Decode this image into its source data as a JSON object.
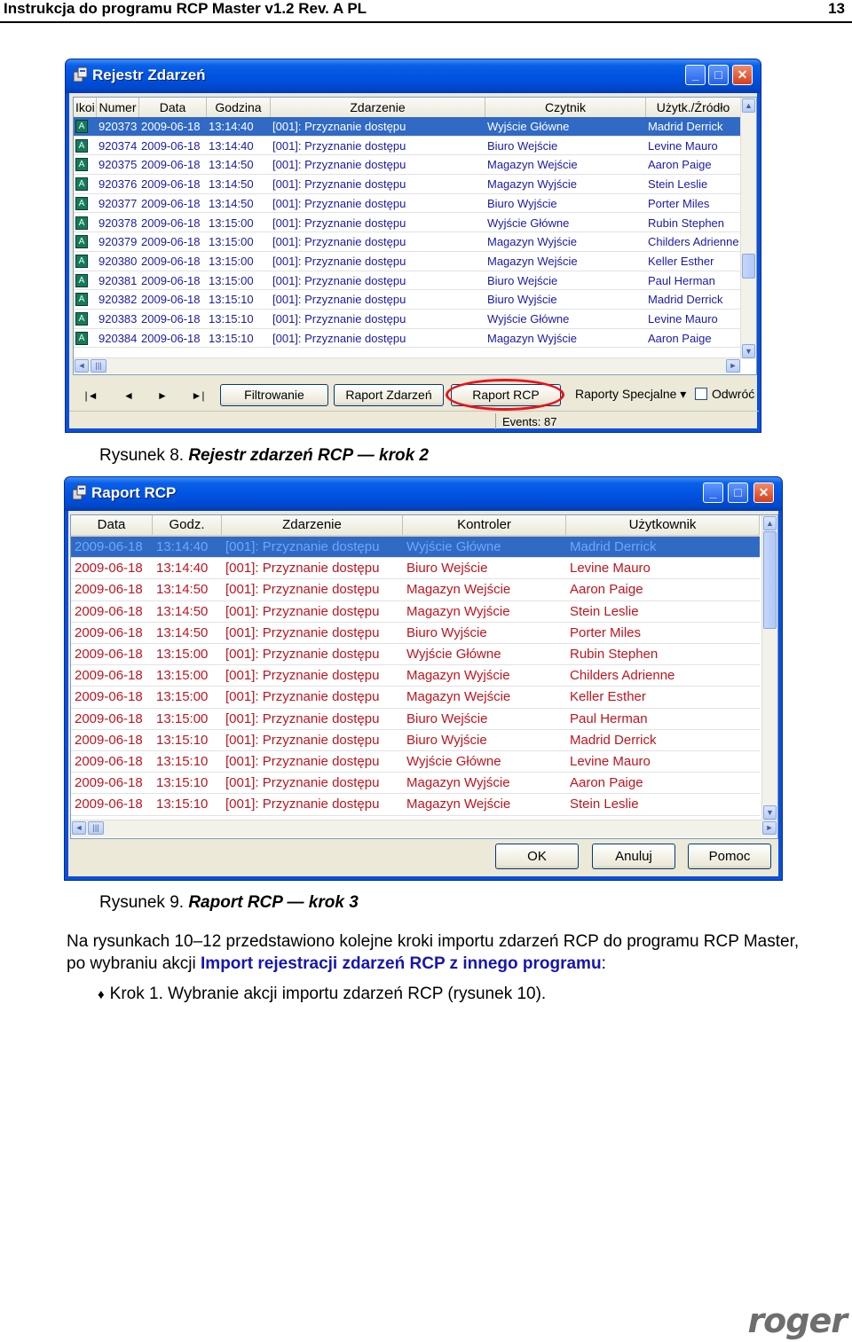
{
  "doc": {
    "header_title": "Instrukcja do programu  RCP Master v1.2 Rev. A PL",
    "page_number": "13"
  },
  "win1": {
    "title": "Rejestr Zdarzeń",
    "columns": [
      "Ikoi",
      "Numer",
      "Data",
      "Godzina",
      "Zdarzenie",
      "Czytnik",
      "Użytk./Źródło"
    ],
    "rows": [
      [
        "920373",
        "2009-06-18",
        "13:14:40",
        "[001]: Przyznanie dostępu",
        "Wyjście Główne",
        "Madrid Derrick"
      ],
      [
        "920374",
        "2009-06-18",
        "13:14:40",
        "[001]: Przyznanie dostępu",
        "Biuro Wejście",
        "Levine Mauro"
      ],
      [
        "920375",
        "2009-06-18",
        "13:14:50",
        "[001]: Przyznanie dostępu",
        "Magazyn Wejście",
        "Aaron Paige"
      ],
      [
        "920376",
        "2009-06-18",
        "13:14:50",
        "[001]: Przyznanie dostępu",
        "Magazyn Wyjście",
        "Stein Leslie"
      ],
      [
        "920377",
        "2009-06-18",
        "13:14:50",
        "[001]: Przyznanie dostępu",
        "Biuro Wyjście",
        "Porter Miles"
      ],
      [
        "920378",
        "2009-06-18",
        "13:15:00",
        "[001]: Przyznanie dostępu",
        "Wyjście Główne",
        "Rubin Stephen"
      ],
      [
        "920379",
        "2009-06-18",
        "13:15:00",
        "[001]: Przyznanie dostępu",
        "Magazyn Wyjście",
        "Childers Adrienne"
      ],
      [
        "920380",
        "2009-06-18",
        "13:15:00",
        "[001]: Przyznanie dostępu",
        "Magazyn Wejście",
        "Keller Esther"
      ],
      [
        "920381",
        "2009-06-18",
        "13:15:00",
        "[001]: Przyznanie dostępu",
        "Biuro Wejście",
        "Paul Herman"
      ],
      [
        "920382",
        "2009-06-18",
        "13:15:10",
        "[001]: Przyznanie dostępu",
        "Biuro Wyjście",
        "Madrid Derrick"
      ],
      [
        "920383",
        "2009-06-18",
        "13:15:10",
        "[001]: Przyznanie dostępu",
        "Wyjście Główne",
        "Levine Mauro"
      ],
      [
        "920384",
        "2009-06-18",
        "13:15:10",
        "[001]: Przyznanie dostępu",
        "Magazyn Wyjście",
        "Aaron Paige"
      ]
    ],
    "buttons": {
      "first": "|◄",
      "prev": "◄",
      "next": "►",
      "last": "►|",
      "filter": "Filtrowanie",
      "report_events": "Raport Zdarzeń",
      "report_rcp": "Raport RCP",
      "special_reports": "Raporty Specjalne ▾",
      "refresh": "Odwróć"
    },
    "status": "Events: 87"
  },
  "caption1": {
    "prefix": "Rysunek 8. ",
    "text": "Rejestr zdarzeń RCP — krok 2"
  },
  "win2": {
    "title": "Raport RCP",
    "columns": [
      "Data",
      "Godz.",
      "Zdarzenie",
      "Kontroler",
      "Użytkownik"
    ],
    "rows": [
      [
        "2009-06-18",
        "13:14:40",
        "[001]: Przyznanie dostępu",
        "Wyjście Główne",
        "Madrid Derrick"
      ],
      [
        "2009-06-18",
        "13:14:40",
        "[001]: Przyznanie dostępu",
        "Biuro Wejście",
        "Levine Mauro"
      ],
      [
        "2009-06-18",
        "13:14:50",
        "[001]: Przyznanie dostępu",
        "Magazyn Wejście",
        "Aaron Paige"
      ],
      [
        "2009-06-18",
        "13:14:50",
        "[001]: Przyznanie dostępu",
        "Magazyn Wyjście",
        "Stein Leslie"
      ],
      [
        "2009-06-18",
        "13:14:50",
        "[001]: Przyznanie dostępu",
        "Biuro Wyjście",
        "Porter Miles"
      ],
      [
        "2009-06-18",
        "13:15:00",
        "[001]: Przyznanie dostępu",
        "Wyjście Główne",
        "Rubin Stephen"
      ],
      [
        "2009-06-18",
        "13:15:00",
        "[001]: Przyznanie dostępu",
        "Magazyn Wyjście",
        "Childers Adrienne"
      ],
      [
        "2009-06-18",
        "13:15:00",
        "[001]: Przyznanie dostępu",
        "Magazyn Wejście",
        "Keller Esther"
      ],
      [
        "2009-06-18",
        "13:15:00",
        "[001]: Przyznanie dostępu",
        "Biuro Wejście",
        "Paul Herman"
      ],
      [
        "2009-06-18",
        "13:15:10",
        "[001]: Przyznanie dostępu",
        "Biuro Wyjście",
        "Madrid Derrick"
      ],
      [
        "2009-06-18",
        "13:15:10",
        "[001]: Przyznanie dostępu",
        "Wyjście Główne",
        "Levine Mauro"
      ],
      [
        "2009-06-18",
        "13:15:10",
        "[001]: Przyznanie dostępu",
        "Magazyn Wyjście",
        "Aaron Paige"
      ],
      [
        "2009-06-18",
        "13:15:10",
        "[001]: Przyznanie dostępu",
        "Magazyn Wejście",
        "Stein Leslie"
      ]
    ],
    "buttons": {
      "ok": "OK",
      "cancel": "Anuluj",
      "help": "Pomoc"
    }
  },
  "caption2": {
    "prefix": "Rysunek 9. ",
    "text": "Raport  RCP — krok 3"
  },
  "paragraph": {
    "text1": "Na rysunkach 10–12 przedstawiono kolejne kroki importu zdarzeń RCP do programu RCP Master,",
    "text2": "po wybraniu akcji ",
    "highlight": "Import rejestracji zdarzeń RCP z innego programu",
    "text3": ":"
  },
  "bullet": {
    "symbol": "♦",
    "text": "Krok 1. Wybranie akcji importu zdarzeń RCP (rysunek 10)."
  },
  "logo": "roger",
  "colors": {
    "xp_blue": "#0054e3",
    "selection": "#316ac5",
    "win1_text": "#1a1aa6",
    "win2_text": "#c0141e",
    "highlight": "#1515b4",
    "oval": "#e8141c"
  }
}
